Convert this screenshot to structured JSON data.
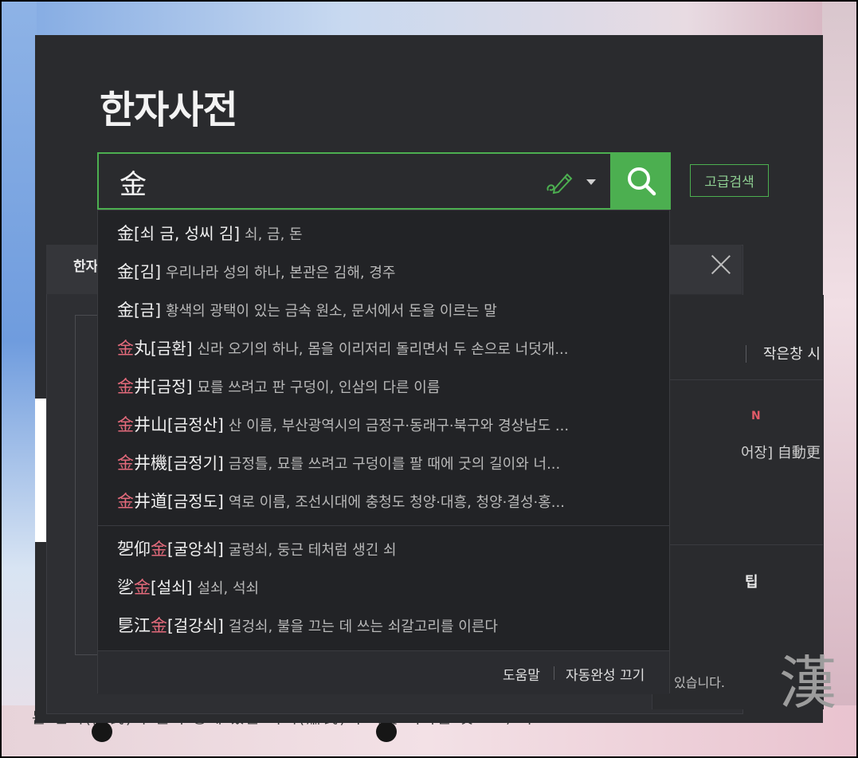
{
  "page_title": "한자사전",
  "search": {
    "value": "金",
    "pen_icon": "handwriting-pen-icon",
    "dropdown_icon": "chevron-down-icon",
    "button_icon": "search-icon",
    "advanced_label": "고급검색"
  },
  "suggestions": [
    {
      "hanja_pre": "",
      "hanja_hl": "",
      "hanja_post": "金",
      "reading": "[쇠 금, 성씨 김]",
      "definition": "쇠, 금, 돈"
    },
    {
      "hanja_pre": "",
      "hanja_hl": "",
      "hanja_post": "金",
      "reading": "[김]",
      "definition": "우리나라 성의 하나, 본관은 김해, 경주"
    },
    {
      "hanja_pre": "",
      "hanja_hl": "",
      "hanja_post": "金",
      "reading": "[금]",
      "definition": "황색의 광택이 있는 금속 원소, 문서에서 돈을 이르는 말"
    },
    {
      "hanja_pre": "",
      "hanja_hl": "金",
      "hanja_post": "丸",
      "reading": "[금환]",
      "definition": "신라 오기의 하나, 몸을 이리저리 돌리면서 두 손으로 너덧개..."
    },
    {
      "hanja_pre": "",
      "hanja_hl": "金",
      "hanja_post": "井",
      "reading": "[금정]",
      "definition": "묘를 쓰려고 판 구덩이, 인삼의 다른 이름"
    },
    {
      "hanja_pre": "",
      "hanja_hl": "金",
      "hanja_post": "井山",
      "reading": "[금정산]",
      "definition": "산 이름, 부산광역시의 금정구·동래구·북구와 경상남도 ..."
    },
    {
      "hanja_pre": "",
      "hanja_hl": "金",
      "hanja_post": "井機",
      "reading": "[금정기]",
      "definition": "금정틀, 묘를 쓰려고 구덩이를 팔 때에 굿의 길이와 너..."
    },
    {
      "hanja_pre": "",
      "hanja_hl": "金",
      "hanja_post": "井道",
      "reading": "[금정도]",
      "definition": "역로 이름, 조선시대에 충청도 청양·대흥, 청양·결성·홍..."
    }
  ],
  "suggestions_more": [
    {
      "hanja_pre": "乫仰",
      "hanja_hl": "金",
      "hanja_post": "",
      "reading": "[굴앙쇠]",
      "definition": "굴렁쇠, 둥근 테처럼 생긴 쇠"
    },
    {
      "hanja_pre": "乷",
      "hanja_hl": "金",
      "hanja_post": "",
      "reading": "[설쇠]",
      "definition": "설쇠, 석쇠"
    },
    {
      "hanja_pre": "乬江",
      "hanja_hl": "金",
      "hanja_post": "",
      "reading": "[걸강쇠]",
      "definition": "걸겅쇠, 불을 끄는 데 쓰는 쇠갈고리를 이른다"
    }
  ],
  "footer": {
    "help": "도움말",
    "autocomplete_off": "자동완성 끄기"
  },
  "background": {
    "tab_label": "한자",
    "small_window": "작은창 시",
    "new_badge": "N",
    "entry_text": "어장] 自動更",
    "tip_text": "팁",
    "notice_text": "있습니다.",
    "big_hanja": "漢",
    "bottom_text": "는 민씨(閔氏)와 원숙 궁에 있는 숙씨(肅氏)의 나뭇 이라는 것으로, 작조"
  },
  "colors": {
    "accent": "#4caf50",
    "highlight": "#e36a7b",
    "panel": "#2a2b2e"
  }
}
